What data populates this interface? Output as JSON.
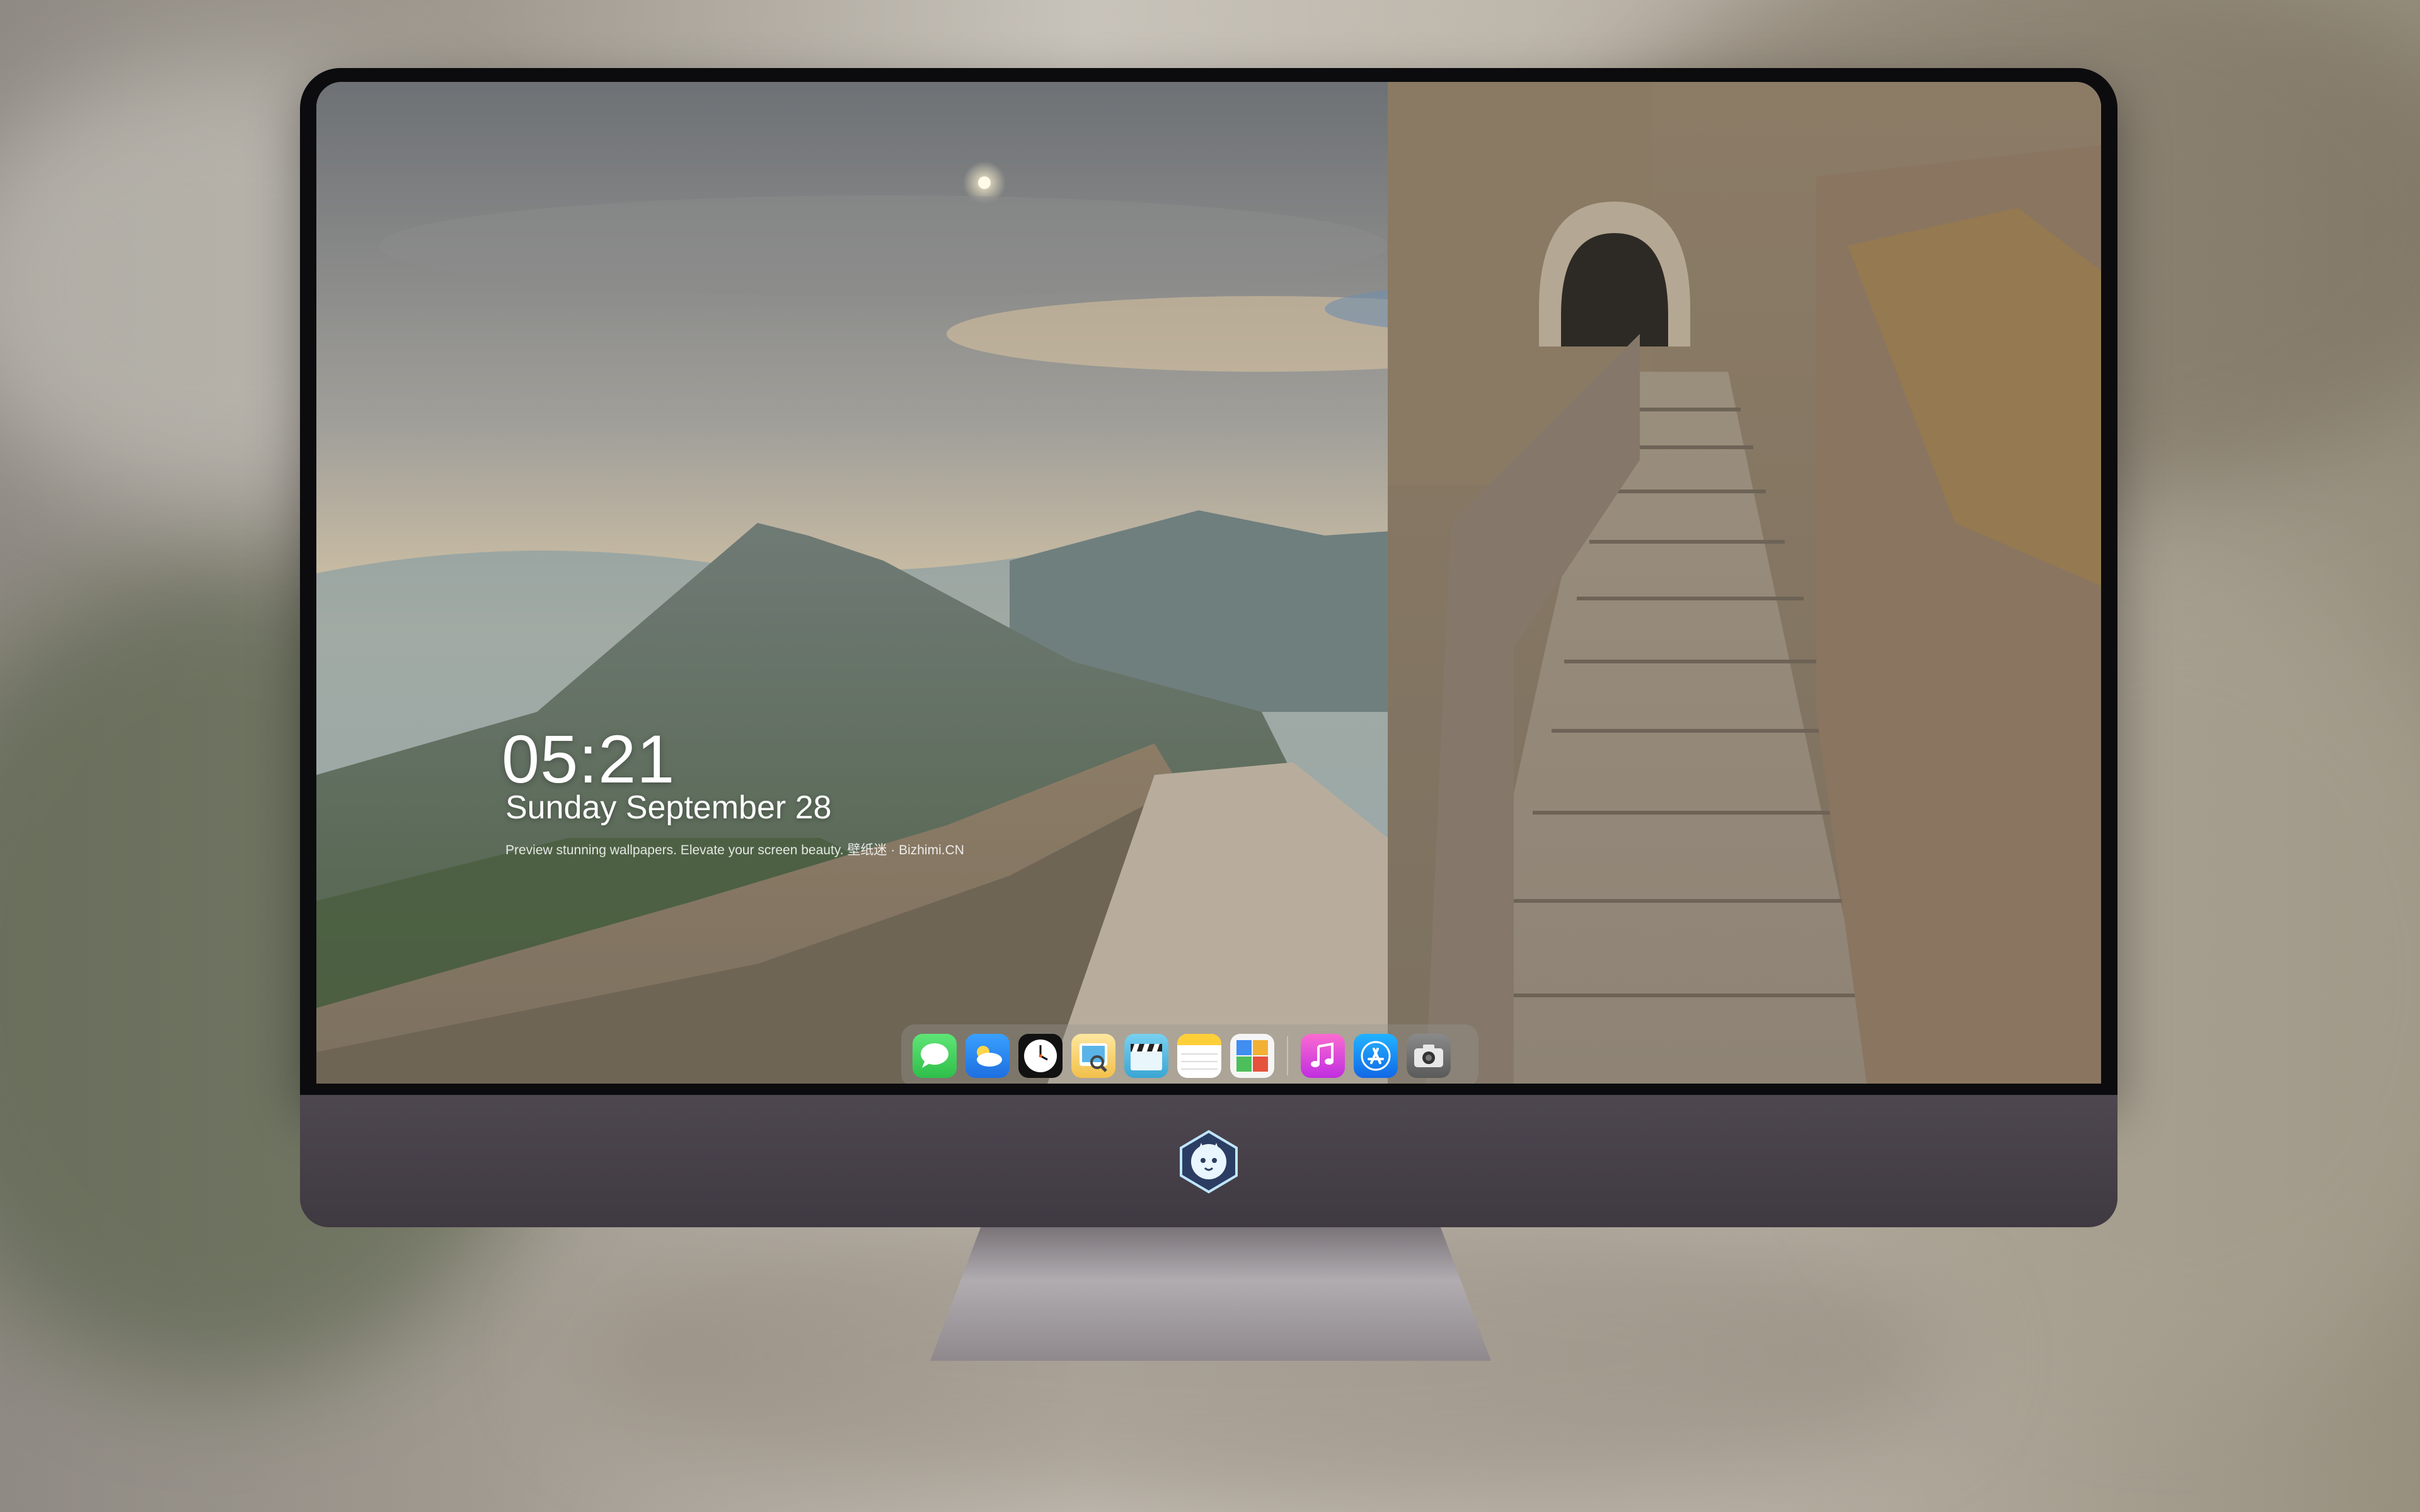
{
  "lockscreen": {
    "time": "05:21",
    "date": "Sunday September  28",
    "tagline": "Preview stunning wallpapers. Elevate your screen beauty. 壁纸迷 · Bizhimi.CN"
  },
  "dock": {
    "apps": [
      {
        "name": "messages-icon",
        "color": "#34c759"
      },
      {
        "name": "weather-icon",
        "color": "#1e90ff"
      },
      {
        "name": "clock-icon",
        "color": "#111111"
      },
      {
        "name": "preview-icon",
        "color": "#f5c542"
      },
      {
        "name": "video-clapper-icon",
        "color": "#3ab4d8"
      },
      {
        "name": "notes-icon",
        "color": "#ffd43b"
      },
      {
        "name": "photo-board-icon",
        "color": "#2f80ed"
      },
      {
        "name": "music-icon",
        "color": "#e83e8c"
      },
      {
        "name": "app-store-icon",
        "color": "#1a8cff"
      },
      {
        "name": "camera-icon",
        "color": "#6b6b6b"
      }
    ]
  },
  "colors": {
    "chin": "#4e4750",
    "bezel": "#0c0c0e"
  }
}
